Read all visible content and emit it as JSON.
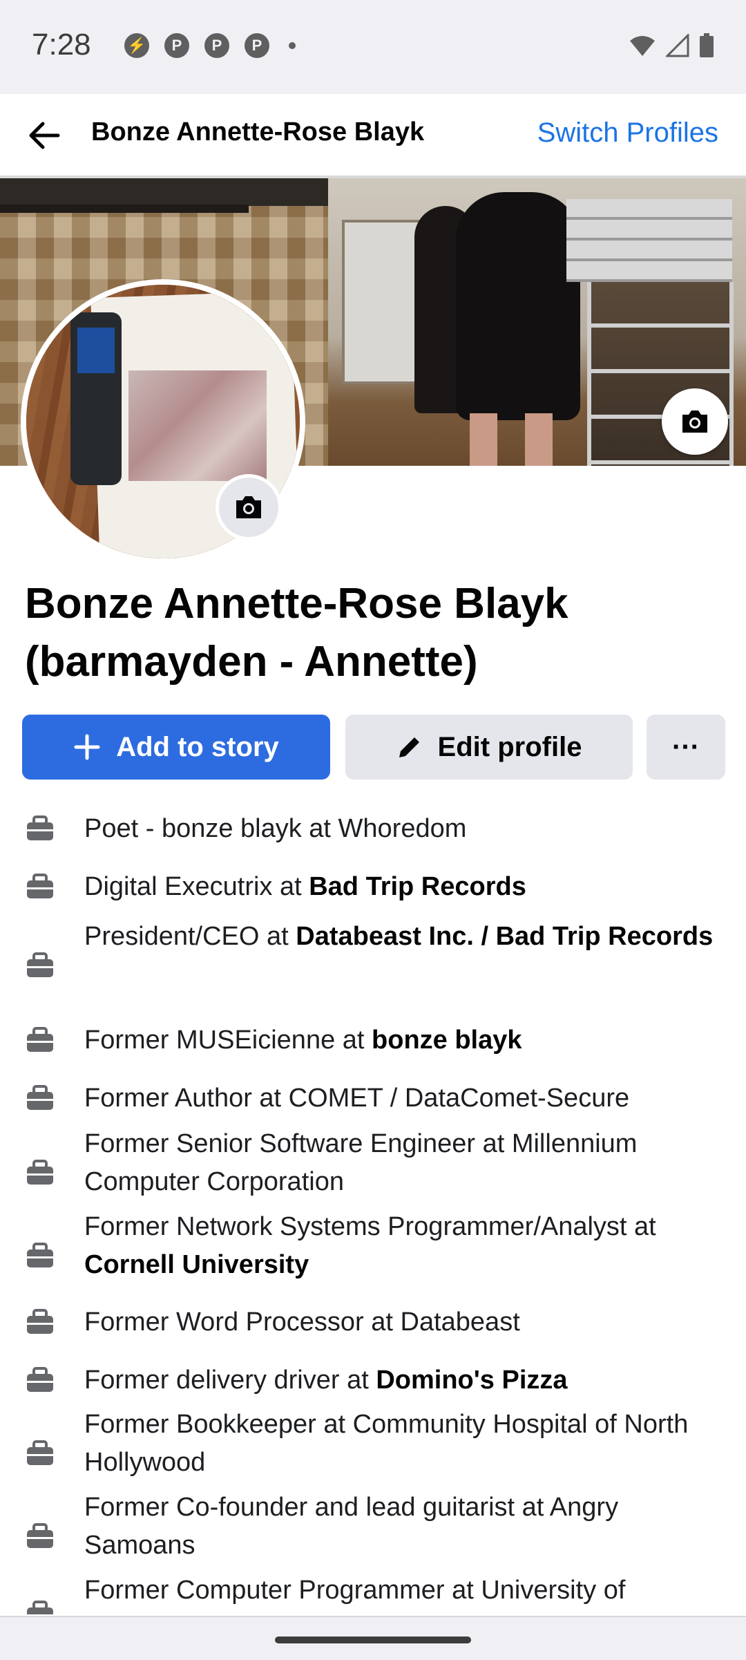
{
  "status_bar": {
    "time": "7:28",
    "left_icons": [
      "messenger-icon",
      "pinterest-icon",
      "pinterest-icon",
      "pinterest-icon",
      "more-dot-icon"
    ],
    "right_icons": [
      "wifi-icon",
      "signal-icon",
      "battery-icon"
    ]
  },
  "header": {
    "title": "Bonze Annette-Rose Blayk",
    "switch_label": "Switch Profiles",
    "accent_color": "#1b74e4"
  },
  "profile": {
    "name": "Bonze Annette-Rose Blayk (barmayden - Annette)"
  },
  "actions": {
    "add_story": "Add to story",
    "edit_profile": "Edit profile",
    "more": "···"
  },
  "work": [
    {
      "prefix": "Poet - bonze blayk at Whoredom",
      "org": ""
    },
    {
      "prefix": "Digital Executrix at ",
      "org": "Bad Trip Records"
    },
    {
      "prefix": "President/CEO at ",
      "org": "Databeast Inc. / Bad Trip Records"
    },
    {
      "prefix": "Former MUSEicienne at ",
      "org": "bonze blayk"
    },
    {
      "prefix": "Former Author at COMET / DataComet-Secure",
      "org": ""
    },
    {
      "prefix": "Former Senior Software Engineer at Millennium Computer Corporation",
      "org": ""
    },
    {
      "prefix": "Former Network Systems Programmer/Analyst at ",
      "org": "Cornell University"
    },
    {
      "prefix": "Former Word Processor at Databeast",
      "org": ""
    },
    {
      "prefix": "Former delivery driver at ",
      "org": "Domino's Pizza"
    },
    {
      "prefix": "Former Bookkeeper at Community Hospital of North Hollywood",
      "org": ""
    },
    {
      "prefix": "Former Co-founder and lead guitarist at Angry Samoans",
      "org": ""
    },
    {
      "prefix": "Former Computer Programmer at University of",
      "org": ""
    }
  ]
}
